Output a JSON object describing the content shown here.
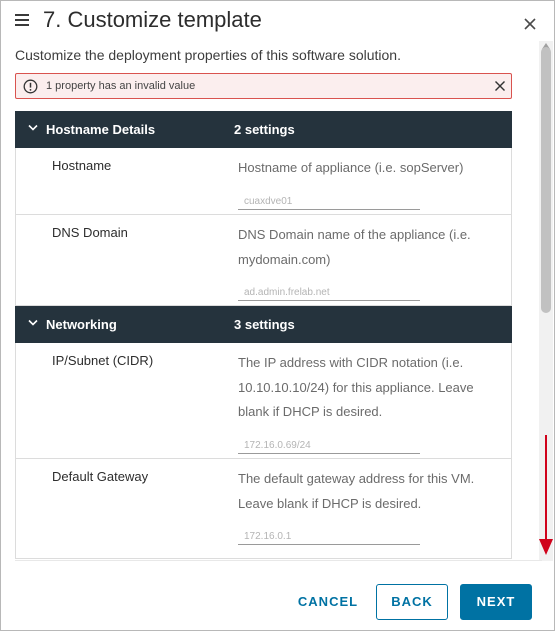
{
  "dialog": {
    "title": "7. Customize template",
    "subtitle": "Customize the deployment properties of this software solution."
  },
  "alert": {
    "text": "1 property has an invalid value"
  },
  "groups": [
    {
      "name": "Hostname Details",
      "count": "2 settings",
      "properties": [
        {
          "label": "Hostname",
          "description": "Hostname of appliance (i.e. sopServer)",
          "value": "cuaxdve01"
        },
        {
          "label": "DNS Domain",
          "description": "DNS Domain name of the appliance (i.e. mydomain.com)",
          "value": "ad.admin.frelab.net"
        }
      ]
    },
    {
      "name": "Networking",
      "count": "3 settings",
      "properties": [
        {
          "label": "IP/Subnet (CIDR)",
          "description": "The IP address with CIDR notation (i.e. 10.10.10.10/24) for this appliance. Leave blank if DHCP is desired.",
          "value": "172.16.0.69/24"
        },
        {
          "label": "Default Gateway",
          "description": "The default gateway address for this VM. Leave blank if DHCP is desired.",
          "value": "172.16.0.1"
        }
      ]
    }
  ],
  "footer": {
    "cancel_label": "CANCEL",
    "back_label": "BACK",
    "next_label": "NEXT"
  },
  "colors": {
    "header_bg": "#25333d",
    "primary": "#0072a3",
    "alert_border": "#d9534f",
    "alert_bg": "#fbeeee",
    "annotation_arrow": "#d0021b"
  },
  "icons": {
    "menu": "hamburger-menu-icon",
    "close": "close-icon",
    "alert": "exclamation-circle-icon",
    "expand": "chevron-down-icon"
  }
}
